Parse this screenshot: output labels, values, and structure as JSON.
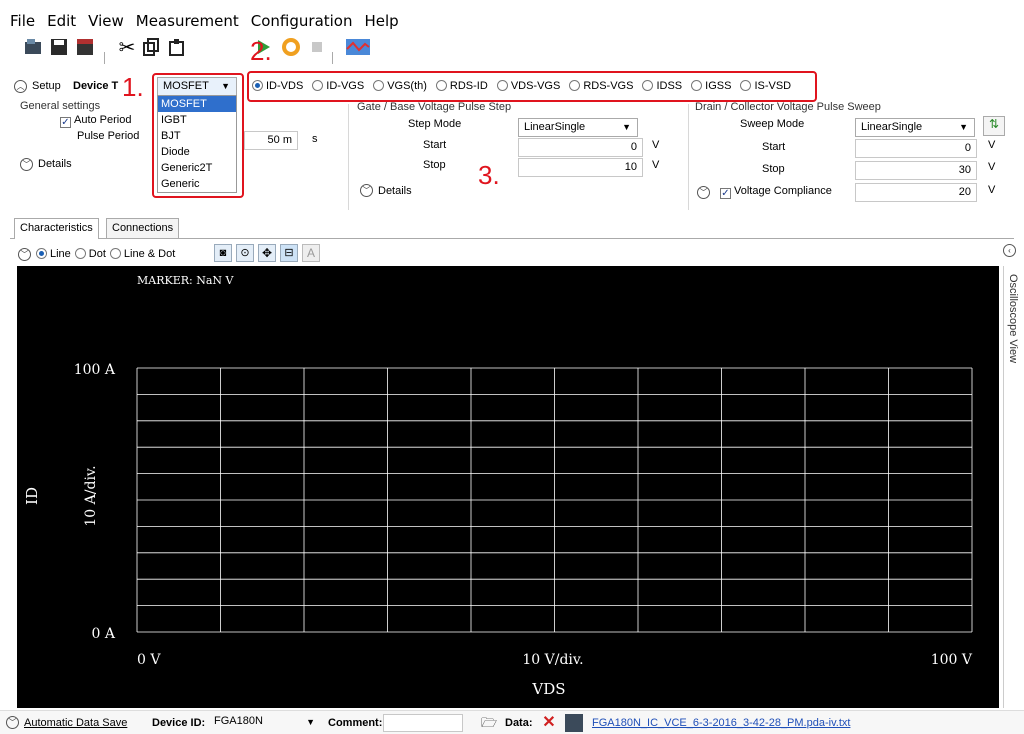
{
  "menu": [
    "File",
    "Edit",
    "View",
    "Measurement",
    "Configuration",
    "Help"
  ],
  "annotations": {
    "n1": "1.",
    "n2": "2.",
    "n3": "3."
  },
  "setup": {
    "toggle_label": "Setup",
    "device_label": "Device T",
    "device_type": "MOSFET",
    "device_options": [
      "MOSFET",
      "IGBT",
      "BJT",
      "Diode",
      "Generic2T",
      "Generic"
    ]
  },
  "measure_modes": [
    "ID-VDS",
    "ID-VGS",
    "VGS(th)",
    "RDS-ID",
    "VDS-VGS",
    "RDS-VGS",
    "IDSS",
    "IGSS",
    "IS-VSD"
  ],
  "selected_mode": "ID-VDS",
  "general": {
    "title": "General settings",
    "auto_period": "Auto Period",
    "pulse_period_label": "Pulse Period",
    "pulse_period_value": "50 m",
    "pulse_period_unit": "s",
    "details": "Details"
  },
  "gate": {
    "title": "Gate / Base Voltage Pulse Step",
    "step_mode_label": "Step Mode",
    "step_mode_value": "LinearSingle",
    "start_label": "Start",
    "start_value": "0",
    "stop_label": "Stop",
    "stop_value": "10",
    "unit": "V",
    "details": "Details"
  },
  "drain": {
    "title": "Drain / Collector Voltage Pulse Sweep",
    "sweep_mode_label": "Sweep Mode",
    "sweep_mode_value": "LinearSingle",
    "start_label": "Start",
    "start_value": "0",
    "stop_label": "Stop",
    "stop_value": "30",
    "compliance_label": "Voltage Compliance",
    "compliance_value": "20",
    "unit": "V"
  },
  "tabs": [
    "Characteristics",
    "Connections"
  ],
  "plot_toolbar": {
    "line": "Line",
    "dot": "Dot",
    "line_dot": "Line & Dot"
  },
  "scope": {
    "marker": "MARKER: NaN V",
    "y_top": "100 A",
    "y_bottom": "0 A",
    "y_div": "10 A/div.",
    "y_title": "ID",
    "x_left": "0 V",
    "x_div": "10 V/div.",
    "x_right": "100 V",
    "x_title": "VDS",
    "grid_color": "#ffffff",
    "background": "#000000"
  },
  "side_panel": "Oscilloscope View",
  "status": {
    "auto_save": "Automatic Data Save",
    "device_id_label": "Device ID:",
    "device_id_value": "FGA180N",
    "comment_label": "Comment:",
    "data_label": "Data:",
    "data_file": "FGA180N_IC_VCE_6-3-2016_3-42-28_PM.pda-iv.txt"
  }
}
